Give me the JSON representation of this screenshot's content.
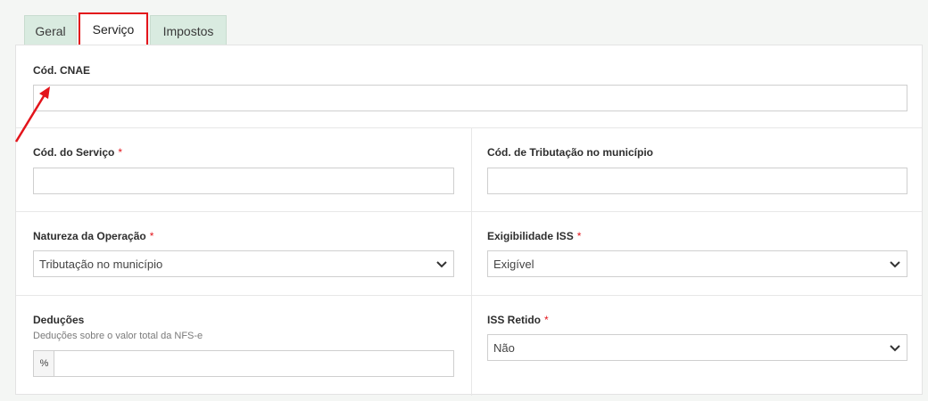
{
  "tabs": [
    {
      "label": "Geral",
      "active": false
    },
    {
      "label": "Serviço",
      "active": true
    },
    {
      "label": "Impostos",
      "active": false
    }
  ],
  "form": {
    "cnae": {
      "label": "Cód. CNAE",
      "value": ""
    },
    "servico": {
      "label": "Cód. do Serviço",
      "required_mark": "*",
      "value": ""
    },
    "tributacao": {
      "label": "Cód. de Tributação no município",
      "value": ""
    },
    "natureza": {
      "label": "Natureza da Operação",
      "required_mark": "*",
      "selected": "Tributação no município"
    },
    "exigibilidade": {
      "label": "Exigibilidade ISS",
      "required_mark": "*",
      "selected": "Exigível"
    },
    "deducoes": {
      "label": "Deduções",
      "help": "Deduções sobre o valor total da NFS-e",
      "addon": "%",
      "value": ""
    },
    "iss_retido": {
      "label": "ISS Retido",
      "required_mark": "*",
      "selected": "Não"
    }
  },
  "colors": {
    "highlight": "#e3141b",
    "tab_bg": "#d9ebe0",
    "required": "#e3141b"
  }
}
